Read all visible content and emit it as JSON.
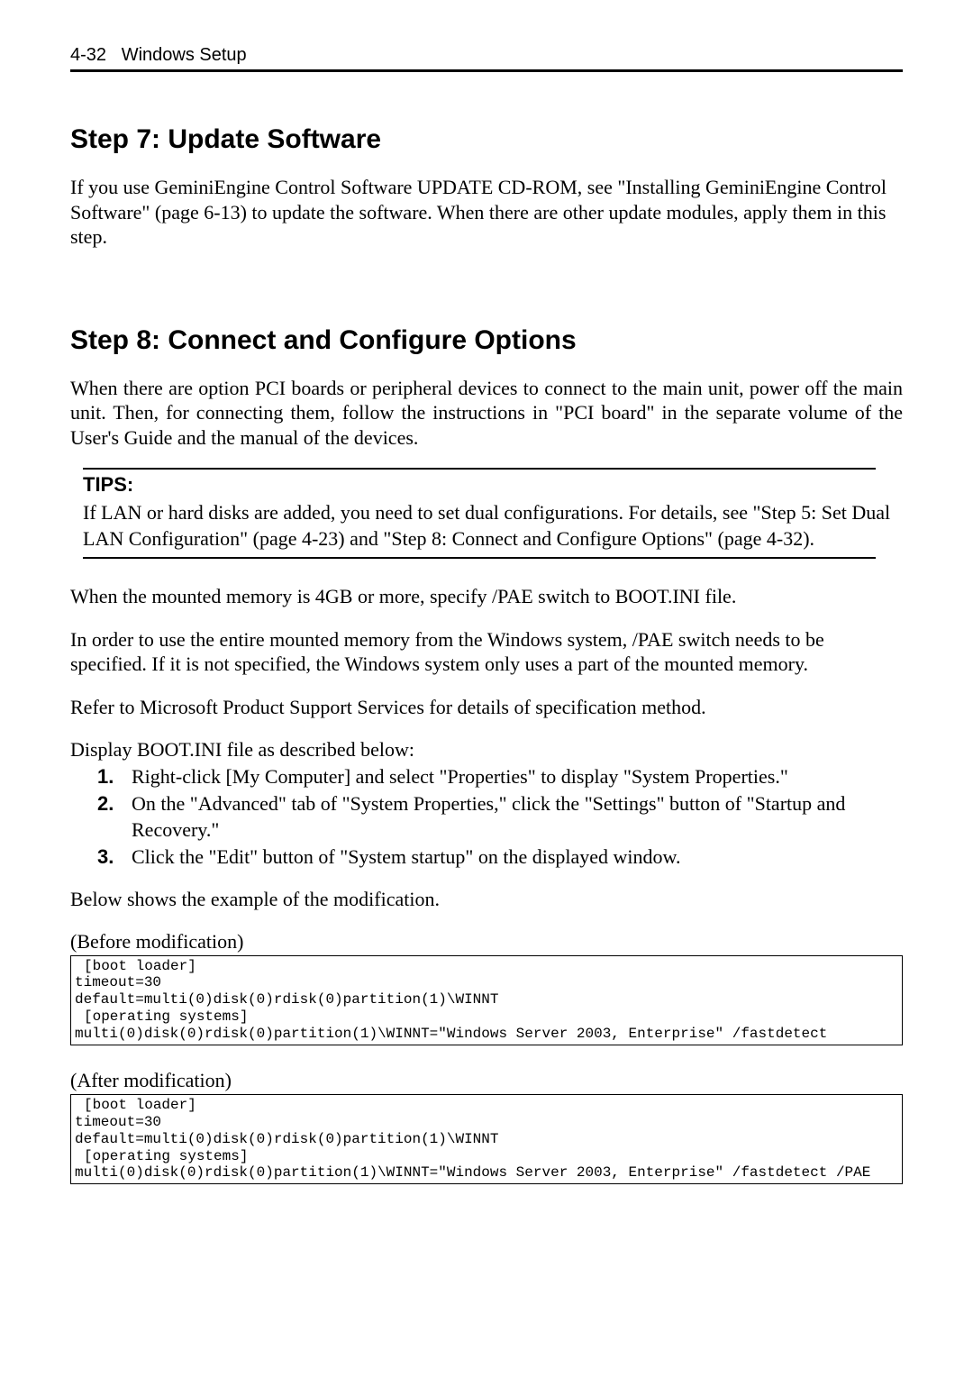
{
  "header": {
    "page_label": "4-32",
    "section_label": "Windows Setup"
  },
  "step7": {
    "title": "Step 7: Update Software",
    "para": "If you use GeminiEngine Control Software UPDATE CD-ROM, see \"Installing GeminiEngine Control Software\" (page 6-13) to update the software. When there are other update modules, apply them in this step."
  },
  "step8": {
    "title": "Step 8: Connect and Configure Options",
    "para1": "When there are option PCI boards or peripheral devices to connect to the main unit, power off the main unit. Then, for connecting them, follow the instructions in \"PCI board\" in the separate volume of the User's Guide and the manual of the devices.",
    "tips_title": "TIPS:",
    "tips_text": "If LAN or hard disks are added, you need to set dual configurations. For details, see \"Step 5: Set Dual LAN Configuration\" (page 4-23) and \"Step 8: Connect and Configure Options\" (page 4-32).",
    "para2": "When the mounted memory is 4GB or more, specify /PAE switch to BOOT.INI file.",
    "para3": "In order to use the entire mounted memory from the Windows system, /PAE switch needs to be specified. If it is not specified, the Windows system only uses a part of the mounted memory.",
    "para4": "Refer to Microsoft Product Support Services for details of specification method.",
    "para5": "Display BOOT.INI file as described below:",
    "steps": [
      "Right-click [My Computer] and select \"Properties\" to display \"System Properties.\"",
      "On the \"Advanced\" tab of \"System Properties,\" click the \"Settings\" button of \"Startup and Recovery.\"",
      "Click the \"Edit\" button of \"System startup\" on the displayed window."
    ],
    "para6": "Below shows the example of the modification.",
    "before_label": "(Before modification)",
    "before_code": {
      "l1": "[boot loader]",
      "l2": "timeout=30",
      "l3": "default=multi(0)disk(0)rdisk(0)partition(1)\\WINNT",
      "l4": "[operating systems]",
      "l5": "multi(0)disk(0)rdisk(0)partition(1)\\WINNT=\"Windows Server 2003, Enterprise\" /fastdetect"
    },
    "after_label": "(After modification)",
    "after_code": {
      "l1": "[boot loader]",
      "l2": "timeout=30",
      "l3": "default=multi(0)disk(0)rdisk(0)partition(1)\\WINNT",
      "l4": "[operating systems]",
      "l5": "multi(0)disk(0)rdisk(0)partition(1)\\WINNT=\"Windows Server 2003, Enterprise\" /fastdetect /PAE"
    }
  }
}
